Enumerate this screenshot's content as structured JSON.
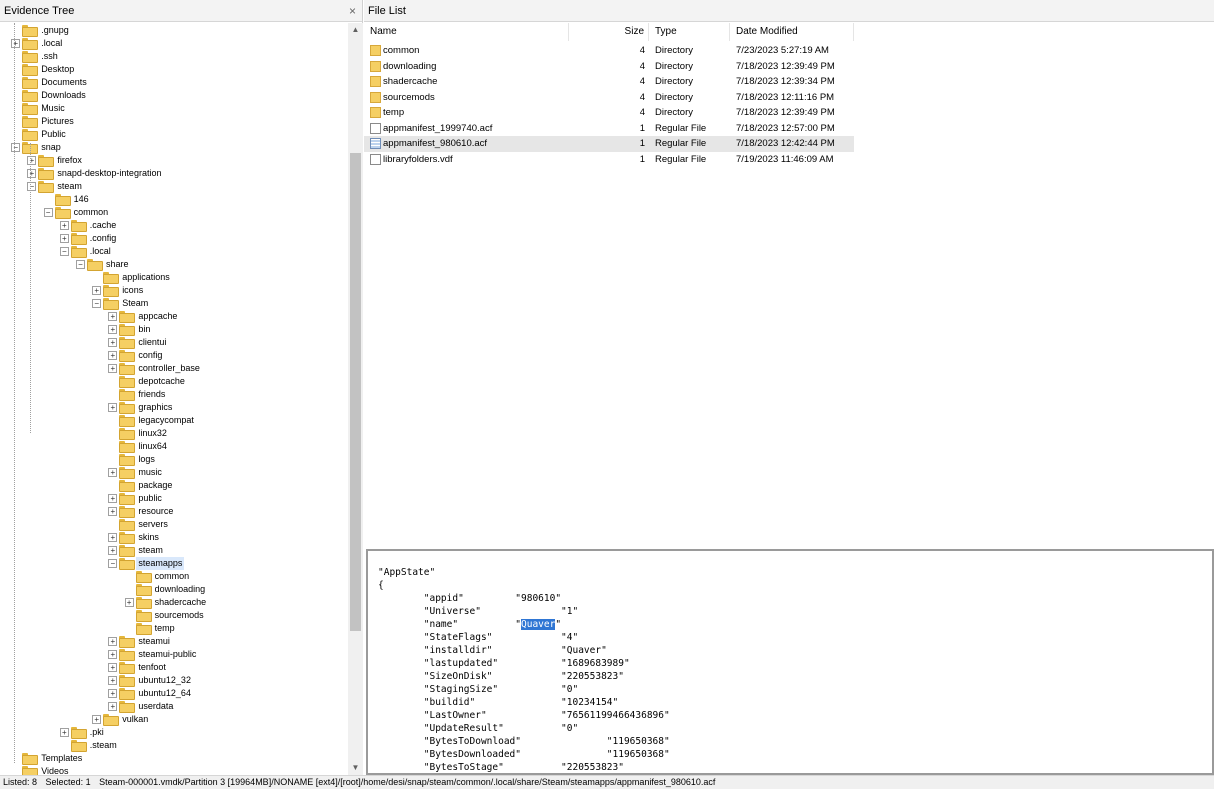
{
  "left_pane": {
    "title": "Evidence Tree",
    "close_label": "×"
  },
  "right_pane": {
    "title": "File List"
  },
  "tree": [
    {
      "label": ".gnupg",
      "depth": 6,
      "expander": ""
    },
    {
      "label": ".local",
      "depth": 6,
      "expander": "+"
    },
    {
      "label": ".ssh",
      "depth": 6,
      "expander": ""
    },
    {
      "label": "Desktop",
      "depth": 6,
      "expander": ""
    },
    {
      "label": "Documents",
      "depth": 6,
      "expander": ""
    },
    {
      "label": "Downloads",
      "depth": 6,
      "expander": ""
    },
    {
      "label": "Music",
      "depth": 6,
      "expander": ""
    },
    {
      "label": "Pictures",
      "depth": 6,
      "expander": ""
    },
    {
      "label": "Public",
      "depth": 6,
      "expander": ""
    },
    {
      "label": "snap",
      "depth": 6,
      "expander": "−"
    },
    {
      "label": "firefox",
      "depth": 7,
      "expander": "+"
    },
    {
      "label": "snapd-desktop-integration",
      "depth": 7,
      "expander": "+"
    },
    {
      "label": "steam",
      "depth": 7,
      "expander": "−"
    },
    {
      "label": "146",
      "depth": 8,
      "expander": ""
    },
    {
      "label": "common",
      "depth": 8,
      "expander": "−"
    },
    {
      "label": ".cache",
      "depth": 9,
      "expander": "+"
    },
    {
      "label": ".config",
      "depth": 9,
      "expander": "+"
    },
    {
      "label": ".local",
      "depth": 9,
      "expander": "−"
    },
    {
      "label": "share",
      "depth": 10,
      "expander": "−"
    },
    {
      "label": "applications",
      "depth": 11,
      "expander": ""
    },
    {
      "label": "icons",
      "depth": 11,
      "expander": "+"
    },
    {
      "label": "Steam",
      "depth": 11,
      "expander": "−"
    },
    {
      "label": "appcache",
      "depth": 12,
      "expander": "+"
    },
    {
      "label": "bin",
      "depth": 12,
      "expander": "+"
    },
    {
      "label": "clientui",
      "depth": 12,
      "expander": "+"
    },
    {
      "label": "config",
      "depth": 12,
      "expander": "+"
    },
    {
      "label": "controller_base",
      "depth": 12,
      "expander": "+"
    },
    {
      "label": "depotcache",
      "depth": 12,
      "expander": ""
    },
    {
      "label": "friends",
      "depth": 12,
      "expander": ""
    },
    {
      "label": "graphics",
      "depth": 12,
      "expander": "+"
    },
    {
      "label": "legacycompat",
      "depth": 12,
      "expander": ""
    },
    {
      "label": "linux32",
      "depth": 12,
      "expander": ""
    },
    {
      "label": "linux64",
      "depth": 12,
      "expander": ""
    },
    {
      "label": "logs",
      "depth": 12,
      "expander": ""
    },
    {
      "label": "music",
      "depth": 12,
      "expander": "+"
    },
    {
      "label": "package",
      "depth": 12,
      "expander": ""
    },
    {
      "label": "public",
      "depth": 12,
      "expander": "+"
    },
    {
      "label": "resource",
      "depth": 12,
      "expander": "+"
    },
    {
      "label": "servers",
      "depth": 12,
      "expander": ""
    },
    {
      "label": "skins",
      "depth": 12,
      "expander": "+"
    },
    {
      "label": "steam",
      "depth": 12,
      "expander": "+"
    },
    {
      "label": "steamapps",
      "depth": 12,
      "expander": "−",
      "selected": true
    },
    {
      "label": "common",
      "depth": 13,
      "expander": ""
    },
    {
      "label": "downloading",
      "depth": 13,
      "expander": ""
    },
    {
      "label": "shadercache",
      "depth": 13,
      "expander": "+"
    },
    {
      "label": "sourcemods",
      "depth": 13,
      "expander": ""
    },
    {
      "label": "temp",
      "depth": 13,
      "expander": ""
    },
    {
      "label": "steamui",
      "depth": 12,
      "expander": "+"
    },
    {
      "label": "steamui-public",
      "depth": 12,
      "expander": "+"
    },
    {
      "label": "tenfoot",
      "depth": 12,
      "expander": "+"
    },
    {
      "label": "ubuntu12_32",
      "depth": 12,
      "expander": "+"
    },
    {
      "label": "ubuntu12_64",
      "depth": 12,
      "expander": "+"
    },
    {
      "label": "userdata",
      "depth": 12,
      "expander": "+"
    },
    {
      "label": "vulkan",
      "depth": 11,
      "expander": "+"
    },
    {
      "label": ".pki",
      "depth": 9,
      "expander": "+"
    },
    {
      "label": ".steam",
      "depth": 9,
      "expander": ""
    },
    {
      "label": "Templates",
      "depth": 6,
      "expander": ""
    },
    {
      "label": "Videos",
      "depth": 6,
      "expander": ""
    }
  ],
  "file_list": {
    "columns": [
      "Name",
      "Size",
      "Type",
      "Date Modified"
    ],
    "rows": [
      {
        "name": "common",
        "size": "4",
        "type": "Directory",
        "modified": "7/23/2023 5:27:19 AM",
        "icon": "folder-icon"
      },
      {
        "name": "downloading",
        "size": "4",
        "type": "Directory",
        "modified": "7/18/2023 12:39:49 PM",
        "icon": "folder-icon"
      },
      {
        "name": "shadercache",
        "size": "4",
        "type": "Directory",
        "modified": "7/18/2023 12:39:34 PM",
        "icon": "folder-icon"
      },
      {
        "name": "sourcemods",
        "size": "4",
        "type": "Directory",
        "modified": "7/18/2023 12:11:16 PM",
        "icon": "folder-icon"
      },
      {
        "name": "temp",
        "size": "4",
        "type": "Directory",
        "modified": "7/18/2023 12:39:49 PM",
        "icon": "folder-icon"
      },
      {
        "name": "appmanifest_1999740.acf",
        "size": "1",
        "type": "Regular File",
        "modified": "7/18/2023 12:57:00 PM",
        "icon": "file-icon"
      },
      {
        "name": "appmanifest_980610.acf",
        "size": "1",
        "type": "Regular File",
        "modified": "7/18/2023 12:42:44 PM",
        "icon": "grid-file-icon",
        "selected": true
      },
      {
        "name": "libraryfolders.vdf",
        "size": "1",
        "type": "Regular File",
        "modified": "7/19/2023 11:46:09 AM",
        "icon": "file-icon"
      }
    ]
  },
  "viewer": {
    "before": "\"AppState\"\n{\n\t\"appid\"\t\t\"980610\"\n\t\"Universe\"\t\t\"1\"\n\t\"name\"\t\t\"",
    "highlight": "Quaver",
    "after": "\"\n\t\"StateFlags\"\t\t\"4\"\n\t\"installdir\"\t\t\"Quaver\"\n\t\"lastupdated\"\t\t\"1689683989\"\n\t\"SizeOnDisk\"\t\t\"220553823\"\n\t\"StagingSize\"\t\t\"0\"\n\t\"buildid\"\t\t\"10234154\"\n\t\"LastOwner\"\t\t\"76561199466436896\"\n\t\"UpdateResult\"\t\t\"0\"\n\t\"BytesToDownload\"\t\t\"119650368\"\n\t\"BytesDownloaded\"\t\t\"119650368\"\n\t\"BytesToStage\"\t\t\"220553823\""
  },
  "status": {
    "listed": "Listed: 8",
    "selected": "Selected: 1",
    "path": "Steam-000001.vmdk/Partition 3 [19964MB]/NONAME [ext4]/[root]/home/desi/snap/steam/common/.local/share/Steam/steamapps/appmanifest_980610.acf"
  }
}
